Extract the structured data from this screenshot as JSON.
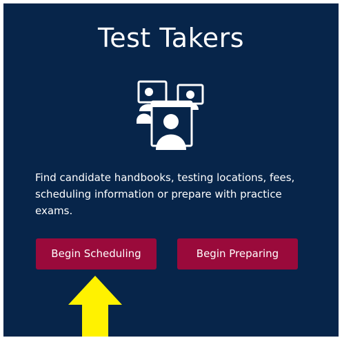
{
  "card": {
    "title": "Test Takers",
    "illustration_icon": "test-takers-icon",
    "description": "Find candidate handbooks, testing locations, fees, scheduling information or prepare with practice exams.",
    "buttons": {
      "schedule_label": "Begin Scheduling",
      "prepare_label": "Begin Preparing"
    }
  },
  "colors": {
    "card_background": "#07254a",
    "button_background": "#9a0a3b",
    "text": "#ffffff",
    "arrow": "#fff200"
  },
  "annotation": {
    "arrow_icon": "arrow-up-icon"
  }
}
